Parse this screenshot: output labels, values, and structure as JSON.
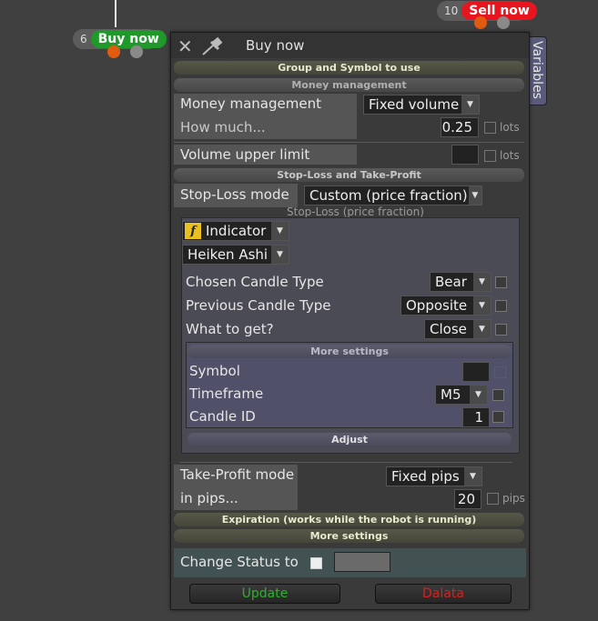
{
  "nodes": {
    "buy": {
      "count": "6",
      "label": "Buy now"
    },
    "sell": {
      "count": "10",
      "label": "Sell now"
    }
  },
  "dialog": {
    "title": "Buy now",
    "variables_tab": "Variables",
    "sections": {
      "group_symbol": "Group and Symbol to use",
      "money_mgmt": "Money management",
      "sl_tp": "Stop-Loss and Take-Profit",
      "expiration": "Expiration (works while the robot is running)",
      "more_settings": "More settings"
    },
    "money_management": {
      "label": "Money management",
      "value": "Fixed volume"
    },
    "how_much": {
      "label": "How much...",
      "value": "0.25",
      "unit": "lots"
    },
    "volume_upper_limit": {
      "label": "Volume upper limit",
      "value": "",
      "unit": "lots"
    },
    "stop_loss_mode": {
      "label": "Stop-Loss mode",
      "value": "Custom (price fraction)",
      "sublabel": "Stop-Loss (price fraction)"
    },
    "indicator": {
      "value": "Indicator",
      "type": "Heiken Ashi"
    },
    "chosen_candle": {
      "label": "Chosen Candle Type",
      "value": "Bear"
    },
    "previous_candle": {
      "label": "Previous Candle Type",
      "value": "Opposite"
    },
    "what_to_get": {
      "label": "What to get?",
      "value": "Close"
    },
    "inner_more_settings": "More settings",
    "symbol": {
      "label": "Symbol",
      "value": ""
    },
    "timeframe": {
      "label": "Timeframe",
      "value": "M5"
    },
    "candle_id": {
      "label": "Candle ID",
      "value": "1"
    },
    "adjust": "Adjust",
    "take_profit_mode": {
      "label": "Take-Profit mode",
      "value": "Fixed pips"
    },
    "in_pips": {
      "label": "in pips...",
      "value": "20",
      "unit": "pips"
    },
    "change_status": {
      "label": "Change Status to",
      "value": ""
    },
    "buttons": {
      "update": "Update",
      "delete": "Dalata"
    }
  },
  "colors": {
    "buy_green": "#1f9a2a",
    "sell_red": "#e8141e",
    "update_text": "#28b428",
    "delete_text": "#d82020"
  }
}
